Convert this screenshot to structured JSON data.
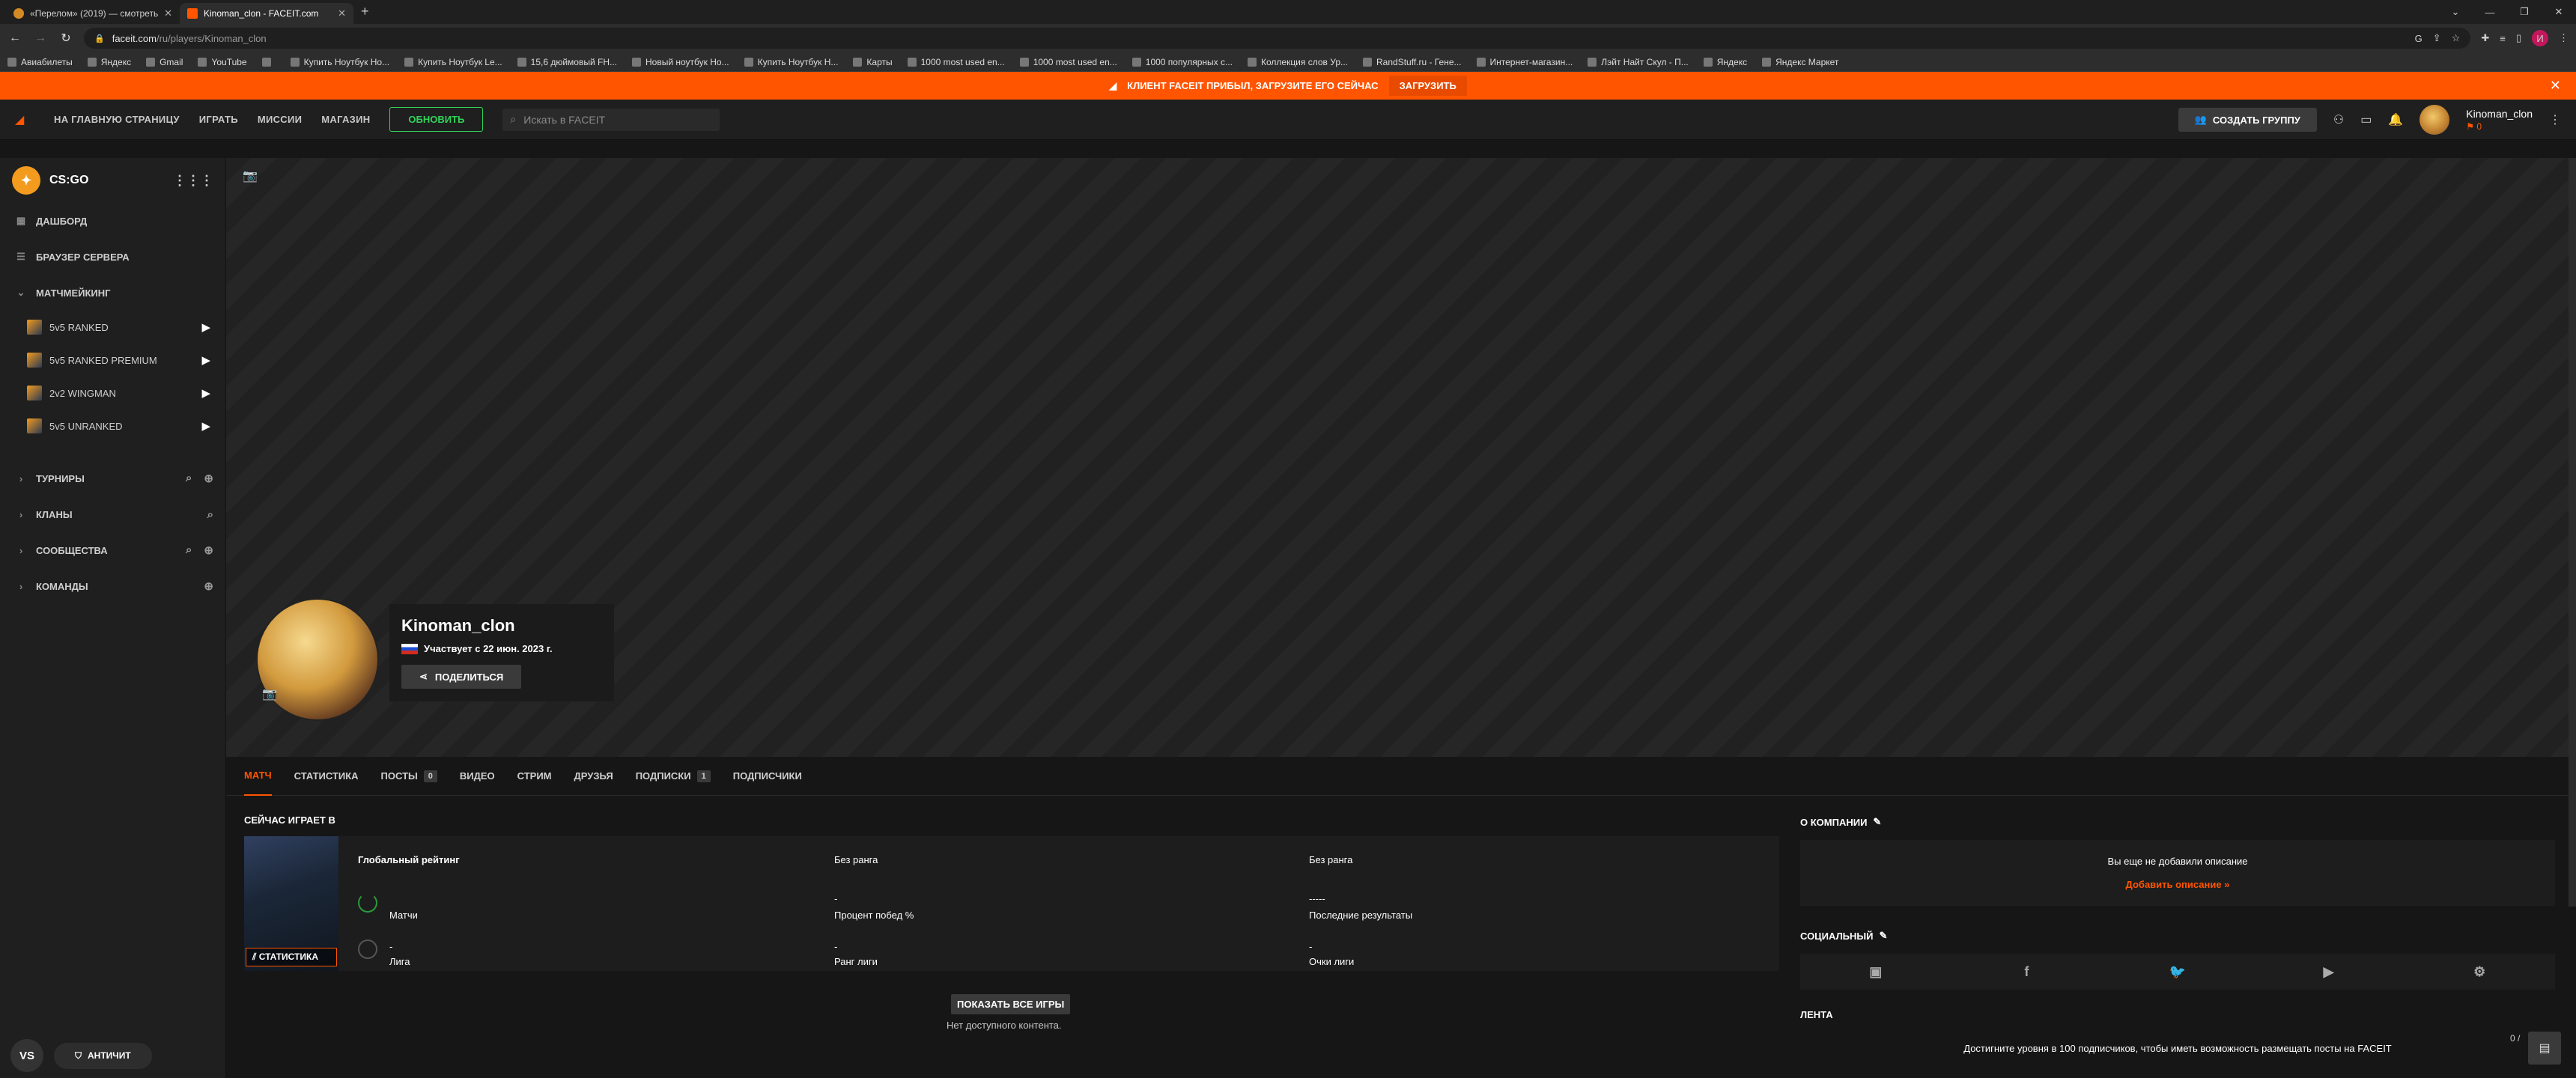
{
  "browser": {
    "tabs": [
      {
        "title": "«Перелом» (2019) — смотреть",
        "active": false
      },
      {
        "title": "Kinoman_clon - FACEIT.com",
        "active": true
      }
    ],
    "new_tab": "+",
    "url_host": "faceit.com",
    "url_path": "/ru/players/Kinoman_clon",
    "profile_letter": "И",
    "bookmarks": [
      "Авиабилеты",
      "Яндекс",
      "Gmail",
      "YouTube",
      "",
      "Купить Ноутбук Но...",
      "Купить Ноутбук Le...",
      "15,6 дюймовый FH...",
      "Новый ноутбук Но...",
      "Купить Ноутбук Н...",
      "Карты",
      "1000 most used en...",
      "1000 most used en...",
      "1000 популярных с...",
      "Коллекция слов Ур...",
      "RandStuff.ru - Гене...",
      "Интернет-магазин...",
      "Лэйт Найт Скул - П...",
      "Яндекс",
      "Яндекс Маркет"
    ]
  },
  "banner": {
    "text": "КЛИЕНТ FACEIT ПРИБЫЛ, ЗАГРУЗИТЕ ЕГО СЕЙЧАС",
    "button": "ЗАГРУЗИТЬ"
  },
  "topnav": {
    "links": [
      "НА ГЛАВНУЮ СТРАНИЦУ",
      "ИГРАТЬ",
      "МИССИИ",
      "МАГАЗИН"
    ],
    "upgrade": "ОБНОВИТЬ",
    "search_placeholder": "Искать в FACEIT",
    "create_group": "СОЗДАТЬ ГРУППУ",
    "username": "Kinoman_clon",
    "points": "0"
  },
  "sidebar": {
    "game": "CS:GO",
    "items": [
      {
        "label": "ДАШБОРД"
      },
      {
        "label": "БРАУЗЕР СЕРВЕРА"
      },
      {
        "label": "МАТЧМЕЙКИНГ"
      }
    ],
    "queues": [
      "5v5 RANKED",
      "5v5 RANKED PREMIUM",
      "2v2 WINGMAN",
      "5v5 UNRANKED"
    ],
    "sections": [
      "ТУРНИРЫ",
      "КЛАНЫ",
      "СООБЩЕСТВА",
      "КОМАНДЫ"
    ],
    "footer_vs": "VS",
    "footer_anticheat": "АНТИЧИТ"
  },
  "profile": {
    "name": "Kinoman_clon",
    "joined": "Участвует с 22 июн. 2023 г.",
    "share": "ПОДЕЛИТЬСЯ",
    "tabs": [
      {
        "label": "МАТЧ"
      },
      {
        "label": "СТАТИСТИКА"
      },
      {
        "label": "ПОСТЫ",
        "count": "0"
      },
      {
        "label": "ВИДЕО"
      },
      {
        "label": "СТРИМ"
      },
      {
        "label": "ДРУЗЬЯ"
      },
      {
        "label": "ПОДПИСКИ",
        "count": "1"
      },
      {
        "label": "ПОДПИСЧИКИ"
      }
    ]
  },
  "playing": {
    "title": "СЕЙЧАС ИГРАЕТ В",
    "stats_btn": "СТАТИСТИКА",
    "global_rating": "Глобальный рейтинг",
    "no_rank_1": "Без ранга",
    "no_rank_2": "Без ранга",
    "matches_value": "",
    "matches": "Матчи",
    "winrate_value": "-",
    "winrate": "Процент побед %",
    "last_results_value": "-----",
    "last_results": "Последние результаты",
    "league_value": "-",
    "league": "Лига",
    "league_rank_value": "-",
    "league_rank": "Ранг лиги",
    "league_points_value": "-",
    "league_points": "Очки лиги",
    "show_all": "ПОКАЗАТЬ ВСЕ ИГРЫ",
    "no_content": "Нет доступного контента."
  },
  "about": {
    "title": "О КОМПАНИИ",
    "empty": "Вы еще не добавили описание",
    "add": "Добавить описание »"
  },
  "social": {
    "title": "СОЦИАЛЬНЫЙ"
  },
  "feed": {
    "title": "ЛЕНТА",
    "message": "Достигните уровня в 100 подписчиков, чтобы иметь возможность размещать посты на FACEIT",
    "count": "0 /"
  }
}
